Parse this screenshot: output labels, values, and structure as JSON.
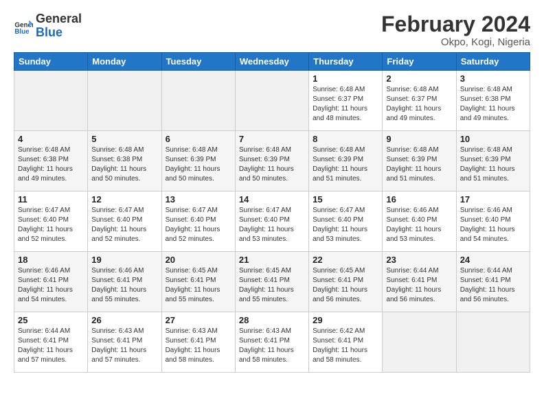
{
  "header": {
    "logo_general": "General",
    "logo_blue": "Blue",
    "month_year": "February 2024",
    "location": "Okpo, Kogi, Nigeria"
  },
  "days_of_week": [
    "Sunday",
    "Monday",
    "Tuesday",
    "Wednesday",
    "Thursday",
    "Friday",
    "Saturday"
  ],
  "weeks": [
    [
      {
        "day": "",
        "info": ""
      },
      {
        "day": "",
        "info": ""
      },
      {
        "day": "",
        "info": ""
      },
      {
        "day": "",
        "info": ""
      },
      {
        "day": "1",
        "info": "Sunrise: 6:48 AM\nSunset: 6:37 PM\nDaylight: 11 hours\nand 48 minutes."
      },
      {
        "day": "2",
        "info": "Sunrise: 6:48 AM\nSunset: 6:37 PM\nDaylight: 11 hours\nand 49 minutes."
      },
      {
        "day": "3",
        "info": "Sunrise: 6:48 AM\nSunset: 6:38 PM\nDaylight: 11 hours\nand 49 minutes."
      }
    ],
    [
      {
        "day": "4",
        "info": "Sunrise: 6:48 AM\nSunset: 6:38 PM\nDaylight: 11 hours\nand 49 minutes."
      },
      {
        "day": "5",
        "info": "Sunrise: 6:48 AM\nSunset: 6:38 PM\nDaylight: 11 hours\nand 50 minutes."
      },
      {
        "day": "6",
        "info": "Sunrise: 6:48 AM\nSunset: 6:39 PM\nDaylight: 11 hours\nand 50 minutes."
      },
      {
        "day": "7",
        "info": "Sunrise: 6:48 AM\nSunset: 6:39 PM\nDaylight: 11 hours\nand 50 minutes."
      },
      {
        "day": "8",
        "info": "Sunrise: 6:48 AM\nSunset: 6:39 PM\nDaylight: 11 hours\nand 51 minutes."
      },
      {
        "day": "9",
        "info": "Sunrise: 6:48 AM\nSunset: 6:39 PM\nDaylight: 11 hours\nand 51 minutes."
      },
      {
        "day": "10",
        "info": "Sunrise: 6:48 AM\nSunset: 6:39 PM\nDaylight: 11 hours\nand 51 minutes."
      }
    ],
    [
      {
        "day": "11",
        "info": "Sunrise: 6:47 AM\nSunset: 6:40 PM\nDaylight: 11 hours\nand 52 minutes."
      },
      {
        "day": "12",
        "info": "Sunrise: 6:47 AM\nSunset: 6:40 PM\nDaylight: 11 hours\nand 52 minutes."
      },
      {
        "day": "13",
        "info": "Sunrise: 6:47 AM\nSunset: 6:40 PM\nDaylight: 11 hours\nand 52 minutes."
      },
      {
        "day": "14",
        "info": "Sunrise: 6:47 AM\nSunset: 6:40 PM\nDaylight: 11 hours\nand 53 minutes."
      },
      {
        "day": "15",
        "info": "Sunrise: 6:47 AM\nSunset: 6:40 PM\nDaylight: 11 hours\nand 53 minutes."
      },
      {
        "day": "16",
        "info": "Sunrise: 6:46 AM\nSunset: 6:40 PM\nDaylight: 11 hours\nand 53 minutes."
      },
      {
        "day": "17",
        "info": "Sunrise: 6:46 AM\nSunset: 6:40 PM\nDaylight: 11 hours\nand 54 minutes."
      }
    ],
    [
      {
        "day": "18",
        "info": "Sunrise: 6:46 AM\nSunset: 6:41 PM\nDaylight: 11 hours\nand 54 minutes."
      },
      {
        "day": "19",
        "info": "Sunrise: 6:46 AM\nSunset: 6:41 PM\nDaylight: 11 hours\nand 55 minutes."
      },
      {
        "day": "20",
        "info": "Sunrise: 6:45 AM\nSunset: 6:41 PM\nDaylight: 11 hours\nand 55 minutes."
      },
      {
        "day": "21",
        "info": "Sunrise: 6:45 AM\nSunset: 6:41 PM\nDaylight: 11 hours\nand 55 minutes."
      },
      {
        "day": "22",
        "info": "Sunrise: 6:45 AM\nSunset: 6:41 PM\nDaylight: 11 hours\nand 56 minutes."
      },
      {
        "day": "23",
        "info": "Sunrise: 6:44 AM\nSunset: 6:41 PM\nDaylight: 11 hours\nand 56 minutes."
      },
      {
        "day": "24",
        "info": "Sunrise: 6:44 AM\nSunset: 6:41 PM\nDaylight: 11 hours\nand 56 minutes."
      }
    ],
    [
      {
        "day": "25",
        "info": "Sunrise: 6:44 AM\nSunset: 6:41 PM\nDaylight: 11 hours\nand 57 minutes."
      },
      {
        "day": "26",
        "info": "Sunrise: 6:43 AM\nSunset: 6:41 PM\nDaylight: 11 hours\nand 57 minutes."
      },
      {
        "day": "27",
        "info": "Sunrise: 6:43 AM\nSunset: 6:41 PM\nDaylight: 11 hours\nand 58 minutes."
      },
      {
        "day": "28",
        "info": "Sunrise: 6:43 AM\nSunset: 6:41 PM\nDaylight: 11 hours\nand 58 minutes."
      },
      {
        "day": "29",
        "info": "Sunrise: 6:42 AM\nSunset: 6:41 PM\nDaylight: 11 hours\nand 58 minutes."
      },
      {
        "day": "",
        "info": ""
      },
      {
        "day": "",
        "info": ""
      }
    ]
  ]
}
